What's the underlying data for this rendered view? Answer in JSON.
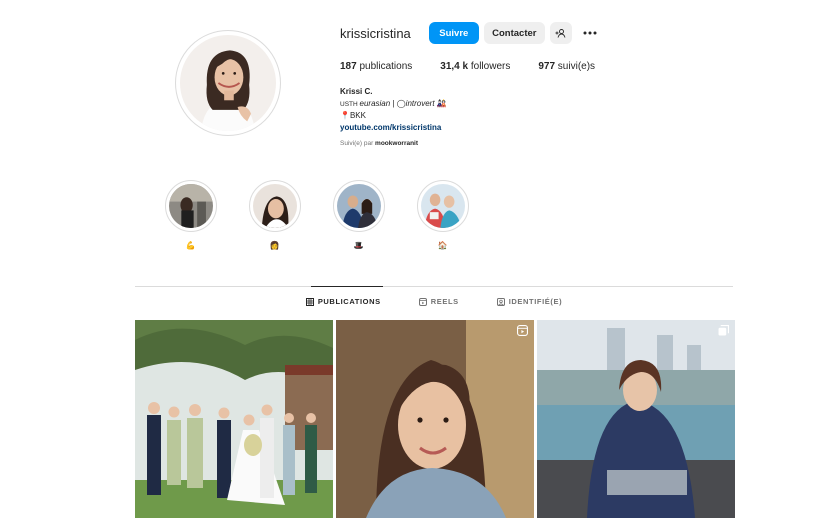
{
  "profile": {
    "username": "krissicristina",
    "follow_label": "Suivre",
    "contact_label": "Contacter"
  },
  "stats": {
    "posts_count": "187",
    "posts_label": " publications",
    "followers_count": "31,4 k",
    "followers_label": " followers",
    "following_count": "977",
    "following_label": " suivi(e)s"
  },
  "bio": {
    "name": "Krissi C.",
    "line1_prefix": "USTH ",
    "line1_italic": "eurasian",
    "line1_mid": " | ",
    "line1_italic2": "introvert",
    "line1_emoji": " 🎎",
    "line2_emoji": "📍",
    "line2_text": "BKK",
    "link": "youtube.com/krissicristina",
    "followed_by_prefix": "Suivi(e) par ",
    "followed_by_user": "mookworranit"
  },
  "highlights": [
    {
      "label": "💪",
      "icon": "flexed-biceps-emoji"
    },
    {
      "label": "👩",
      "icon": "woman-emoji"
    },
    {
      "label": "🎩",
      "icon": "top-hat-emoji"
    },
    {
      "label": "🏠",
      "icon": "house-emoji"
    }
  ],
  "tabs": [
    {
      "label": "PUBLICATIONS",
      "icon": "grid-icon",
      "active": true
    },
    {
      "label": "REELS",
      "icon": "reels-icon",
      "active": false
    },
    {
      "label": "IDENTIFIÉ(E)",
      "icon": "tagged-icon",
      "active": false
    }
  ],
  "posts": [
    {
      "subject": "wedding-group-photo",
      "badge": "none"
    },
    {
      "subject": "portrait-smiling-woman",
      "badge": "reel-icon"
    },
    {
      "subject": "woman-waterfront-city",
      "badge": "carousel-icon"
    }
  ],
  "colors": {
    "follow_button": "#0095f6",
    "secondary_button": "#efefef",
    "link": "#00376b",
    "muted_text": "#737373",
    "divider": "#dbdbdb"
  }
}
